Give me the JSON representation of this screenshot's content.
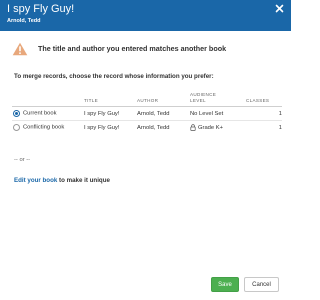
{
  "header": {
    "title": "I spy Fly Guy!",
    "subtitle": "Arnold, Tedd"
  },
  "warning": {
    "text": "The title and author you entered matches another book",
    "color": "#e8a87c"
  },
  "instruction": "To merge records, choose the record whose information you prefer:",
  "table": {
    "columns": [
      "TITLE",
      "AUTHOR",
      "AUDIENCE LEVEL",
      "CLASSES"
    ],
    "rows": [
      {
        "label": "Current book",
        "selected": true,
        "title": "I spy Fly Guy!",
        "author": "Arnold, Tedd",
        "audience": "No Level Set",
        "audience_icon": "",
        "classes": "1"
      },
      {
        "label": "Conflicting book",
        "selected": false,
        "title": "I spy Fly Guy!",
        "author": "Arnold, Tedd",
        "audience": "Grade K+",
        "audience_icon": "lock-icon",
        "classes": "1"
      }
    ]
  },
  "or_text": "-- or --",
  "edit": {
    "link": "Edit your book",
    "rest": " to make it unique"
  },
  "buttons": {
    "save": "Save",
    "cancel": "Cancel"
  },
  "colors": {
    "header": "#1a67a8",
    "link": "#1a67a8",
    "save": "#4caf50"
  }
}
